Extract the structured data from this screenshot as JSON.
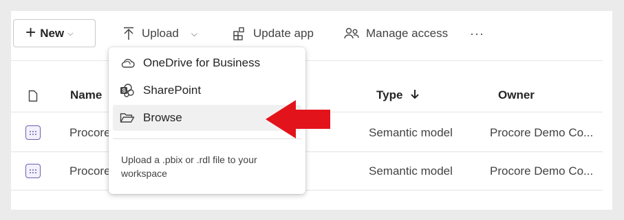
{
  "toolbar": {
    "new_label": "New",
    "upload_label": "Upload",
    "update_app_label": "Update app",
    "manage_access_label": "Manage access",
    "more_label": "···"
  },
  "table": {
    "headers": {
      "name": "Name",
      "type": "Type",
      "owner": "Owner"
    },
    "rows": [
      {
        "name": "Procore",
        "type": "Semantic model",
        "owner": "Procore Demo Co..."
      },
      {
        "name": "Procore",
        "type": "Semantic model",
        "owner": "Procore Demo Co..."
      }
    ]
  },
  "upload_menu": {
    "items": [
      {
        "label": "OneDrive for Business",
        "icon": "cloud-icon"
      },
      {
        "label": "SharePoint",
        "icon": "sharepoint-icon"
      },
      {
        "label": "Browse",
        "icon": "folder-open-icon"
      }
    ],
    "help_text": "Upload a .pbix or .rdl file to your workspace"
  },
  "annotation": {
    "arrow_color": "#e3131b"
  },
  "colors": {
    "semantic_model_icon": "#6b5fb5"
  }
}
